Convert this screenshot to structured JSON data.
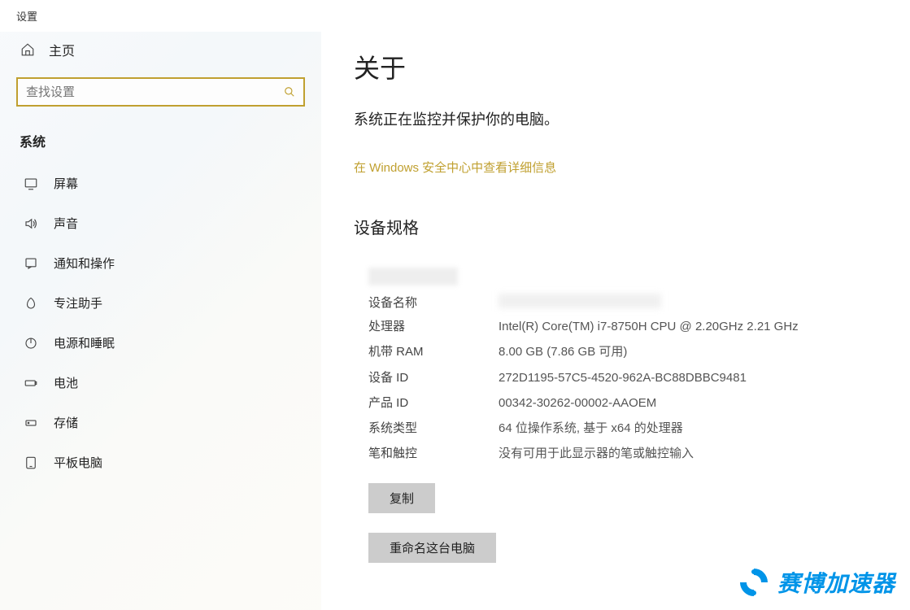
{
  "window_title": "设置",
  "sidebar": {
    "home_label": "主页",
    "search_placeholder": "查找设置",
    "section_label": "系统",
    "items": [
      {
        "label": "屏幕",
        "icon": "display-icon"
      },
      {
        "label": "声音",
        "icon": "sound-icon"
      },
      {
        "label": "通知和操作",
        "icon": "notification-icon"
      },
      {
        "label": "专注助手",
        "icon": "focus-icon"
      },
      {
        "label": "电源和睡眠",
        "icon": "power-icon"
      },
      {
        "label": "电池",
        "icon": "battery-icon"
      },
      {
        "label": "存储",
        "icon": "storage-icon"
      },
      {
        "label": "平板电脑",
        "icon": "tablet-icon"
      }
    ]
  },
  "main": {
    "title": "关于",
    "protect_text": "系统正在监控并保护你的电脑。",
    "security_link": "在 Windows 安全中心中查看详细信息",
    "spec_title": "设备规格",
    "specs": {
      "device_name_label": "设备名称",
      "device_name_value": "",
      "processor_label": "处理器",
      "processor_value": "Intel(R) Core(TM) i7-8750H CPU @ 2.20GHz 2.21 GHz",
      "ram_label": "机带 RAM",
      "ram_value": "8.00 GB (7.86 GB 可用)",
      "device_id_label": "设备 ID",
      "device_id_value": "272D1195-57C5-4520-962A-BC88DBBC9481",
      "product_id_label": "产品 ID",
      "product_id_value": "00342-30262-00002-AAOEM",
      "system_type_label": "系统类型",
      "system_type_value": "64 位操作系统, 基于 x64 的处理器",
      "pen_touch_label": "笔和触控",
      "pen_touch_value": "没有可用于此显示器的笔或触控输入"
    },
    "copy_button": "复制",
    "rename_button": "重命名这台电脑"
  },
  "watermark": {
    "text": "赛博加速器"
  }
}
